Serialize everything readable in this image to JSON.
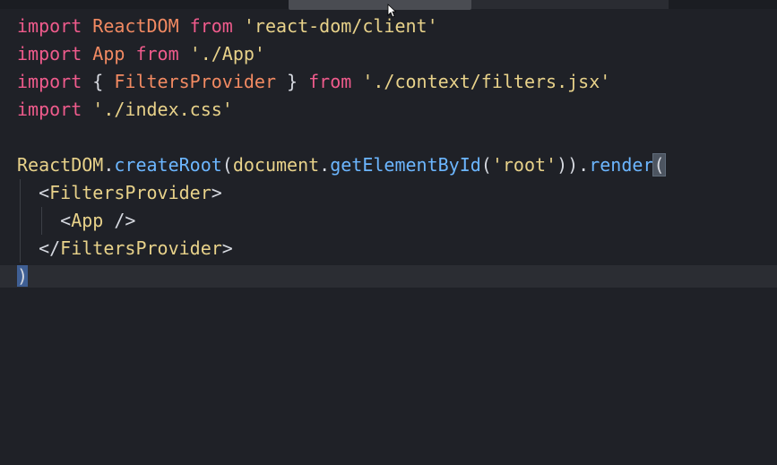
{
  "editor": {
    "language": "jsx",
    "lines": [
      {
        "tokens": [
          {
            "text": "import",
            "kind": "kw"
          },
          {
            "text": " ",
            "kind": "pl"
          },
          {
            "text": "ReactDOM",
            "kind": "id"
          },
          {
            "text": " ",
            "kind": "pl"
          },
          {
            "text": "from",
            "kind": "kw"
          },
          {
            "text": " ",
            "kind": "pl"
          },
          {
            "text": "'react-dom/client'",
            "kind": "str"
          }
        ]
      },
      {
        "tokens": [
          {
            "text": "import",
            "kind": "kw"
          },
          {
            "text": " ",
            "kind": "pl"
          },
          {
            "text": "App",
            "kind": "id"
          },
          {
            "text": " ",
            "kind": "pl"
          },
          {
            "text": "from",
            "kind": "kw"
          },
          {
            "text": " ",
            "kind": "pl"
          },
          {
            "text": "'./App'",
            "kind": "str"
          }
        ]
      },
      {
        "tokens": [
          {
            "text": "import",
            "kind": "kw"
          },
          {
            "text": " { ",
            "kind": "pl"
          },
          {
            "text": "FiltersProvider",
            "kind": "id"
          },
          {
            "text": " } ",
            "kind": "pl"
          },
          {
            "text": "from",
            "kind": "kw"
          },
          {
            "text": " ",
            "kind": "pl"
          },
          {
            "text": "'./context/filters.jsx'",
            "kind": "str"
          }
        ]
      },
      {
        "tokens": [
          {
            "text": "import",
            "kind": "kw"
          },
          {
            "text": " ",
            "kind": "pl"
          },
          {
            "text": "'./index.css'",
            "kind": "str"
          }
        ]
      },
      {
        "tokens": []
      },
      {
        "tokens": [
          {
            "text": "ReactDOM",
            "kind": "tag"
          },
          {
            "text": ".",
            "kind": "pl"
          },
          {
            "text": "createRoot",
            "kind": "fn"
          },
          {
            "text": "(",
            "kind": "pl"
          },
          {
            "text": "document",
            "kind": "tag"
          },
          {
            "text": ".",
            "kind": "pl"
          },
          {
            "text": "getElementById",
            "kind": "fn"
          },
          {
            "text": "(",
            "kind": "pl"
          },
          {
            "text": "'root'",
            "kind": "str"
          },
          {
            "text": ")).",
            "kind": "pl"
          },
          {
            "text": "render",
            "kind": "fn"
          },
          {
            "text": "(",
            "kind": "match-br"
          }
        ]
      },
      {
        "tokens": [
          {
            "text": "  <",
            "kind": "pl"
          },
          {
            "text": "FiltersProvider",
            "kind": "tag"
          },
          {
            "text": ">",
            "kind": "pl"
          }
        ]
      },
      {
        "tokens": [
          {
            "text": "    <",
            "kind": "pl"
          },
          {
            "text": "App",
            "kind": "tag"
          },
          {
            "text": " />",
            "kind": "pl"
          }
        ]
      },
      {
        "tokens": [
          {
            "text": "  </",
            "kind": "pl"
          },
          {
            "text": "FiltersProvider",
            "kind": "tag"
          },
          {
            "text": ">",
            "kind": "pl"
          }
        ]
      },
      {
        "tokens": [
          {
            "text": ")",
            "kind": "cursor-br"
          }
        ]
      }
    ]
  }
}
